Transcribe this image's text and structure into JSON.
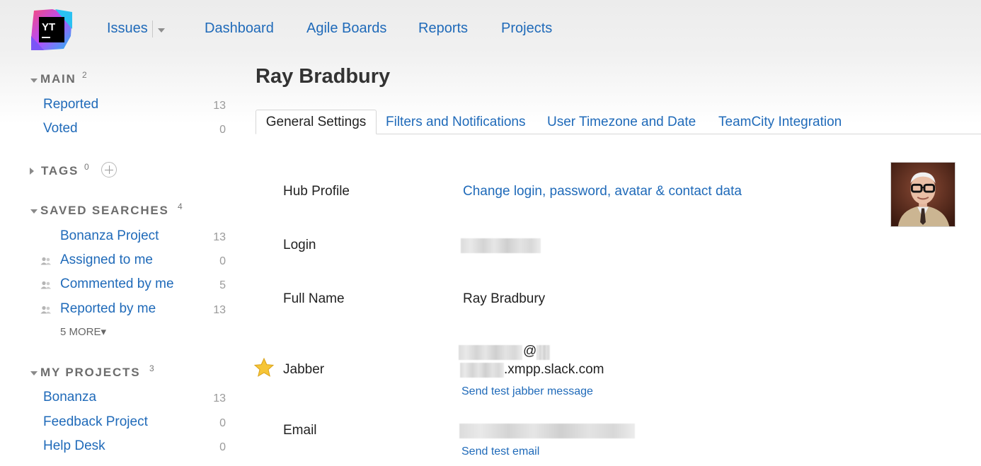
{
  "header": {
    "logo_text": "YT",
    "nav": {
      "issues": "Issues",
      "dashboard": "Dashboard",
      "agile_boards": "Agile Boards",
      "reports": "Reports",
      "projects": "Projects"
    }
  },
  "sidebar": {
    "main": {
      "title": "MAIN",
      "count": "2",
      "items": [
        {
          "label": "Reported",
          "count": "13"
        },
        {
          "label": "Voted",
          "count": "0"
        }
      ]
    },
    "tags": {
      "title": "TAGS",
      "count": "0"
    },
    "saved_searches": {
      "title": "SAVED SEARCHES",
      "count": "4",
      "items": [
        {
          "label": "Bonanza Project",
          "count": "13"
        },
        {
          "label": "Assigned to me",
          "count": "0"
        },
        {
          "label": "Commented by me",
          "count": "5"
        },
        {
          "label": "Reported by me",
          "count": "13"
        }
      ],
      "more": "5 MORE▾"
    },
    "my_projects": {
      "title": "MY PROJECTS",
      "count": "3",
      "items": [
        {
          "label": "Bonanza",
          "count": "13"
        },
        {
          "label": "Feedback Project",
          "count": "0"
        },
        {
          "label": "Help Desk",
          "count": "0"
        }
      ]
    }
  },
  "main": {
    "title": "Ray Bradbury",
    "tabs": [
      {
        "label": "General Settings",
        "active": true
      },
      {
        "label": "Filters and Notifications",
        "active": false
      },
      {
        "label": "User Timezone and Date",
        "active": false
      },
      {
        "label": "TeamCity Integration",
        "active": false
      }
    ],
    "fields": {
      "hub_profile": {
        "label": "Hub Profile",
        "link": "Change login, password, avatar & contact data"
      },
      "login": {
        "label": "Login"
      },
      "full_name": {
        "label": "Full Name",
        "value": "Ray Bradbury"
      },
      "jabber": {
        "label": "Jabber",
        "at": "@",
        "domain_suffix": ".xmpp.slack.com",
        "test_link": "Send test jabber message"
      },
      "email": {
        "label": "Email",
        "test_link": "Send test email"
      }
    }
  },
  "colors": {
    "link": "#1f6ab9",
    "heading_gray": "#6d6d6d",
    "count_gray": "#9a9a9a"
  }
}
